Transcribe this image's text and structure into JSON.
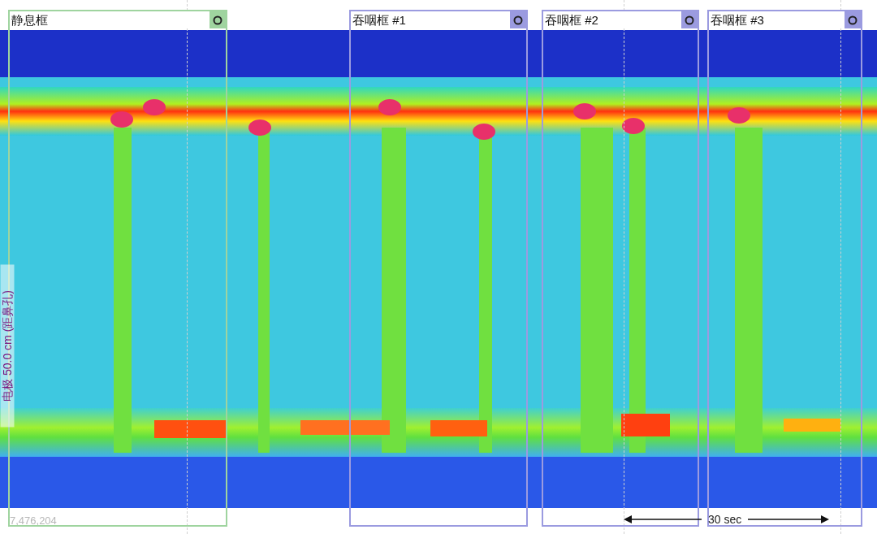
{
  "plot": {
    "axis_label": "电极 50.0 cm (距鼻孔)",
    "counter": "7,476,204"
  },
  "frames": [
    {
      "label": "静息框",
      "color": "#9fd49f"
    },
    {
      "label": "吞咽框 #1",
      "color": "#9b9be0"
    },
    {
      "label": "吞咽框 #2",
      "color": "#9b9be0"
    },
    {
      "label": "吞咽框 #3",
      "color": "#9b9be0"
    }
  ],
  "scale_bar": {
    "label": "30 sec"
  }
}
